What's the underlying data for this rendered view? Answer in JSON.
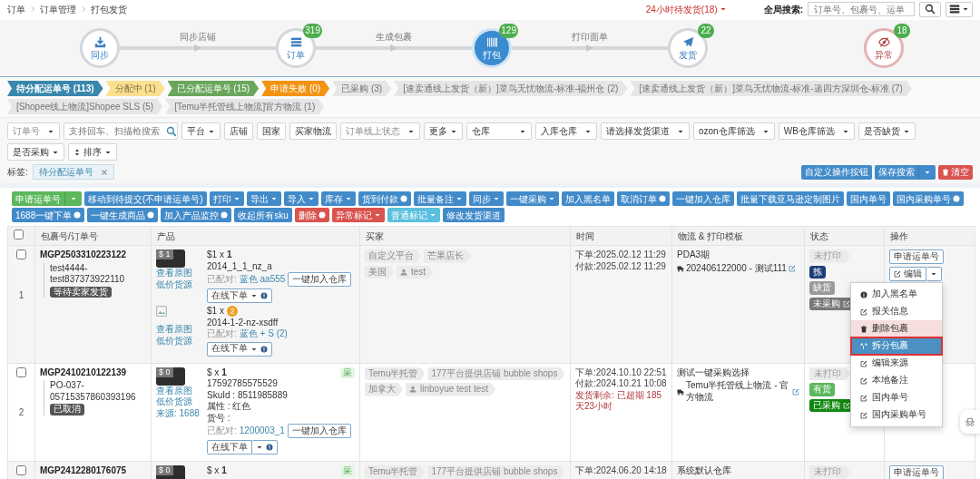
{
  "header": {
    "breadcrumb": [
      "订单",
      "订单管理",
      "打包发货"
    ],
    "alert_link": "24小时待发货(18)",
    "search_label": "全局搜索:",
    "search": {
      "placeholder": "订单号、包裹号、运单"
    }
  },
  "workflow": [
    {
      "kind": "sync",
      "label": "同步",
      "next_label": "同步店铺",
      "selected": false
    },
    {
      "kind": "orders",
      "label": "订单",
      "badge": "319",
      "next_label": "生成包裹",
      "selected": false
    },
    {
      "kind": "pack",
      "label": "打包",
      "badge": "129",
      "next_label": "打印面单",
      "selected": true
    },
    {
      "kind": "ship",
      "label": "发货",
      "badge": "22",
      "selected": false
    },
    {
      "kind": "error",
      "label": "异常",
      "badge": "18",
      "selected": false
    }
  ],
  "status_tabs": [
    {
      "label": "待分配运单号 (113)",
      "color": "#3a87ad",
      "selected": true
    },
    {
      "label": "分配中 (1)",
      "color": "#fbe08f",
      "selected": false
    },
    {
      "label": "已分配运单号 (15)",
      "color": "#6aa65b",
      "selected": false
    },
    {
      "label": "申请失败 (0)",
      "color": "#f39312",
      "selected": false
    },
    {
      "label": "已采购 (3)",
      "color": "#e6e6e6",
      "selected": false
    },
    {
      "label": "[速卖通线上发货（新）]菜鸟无忧物流-标准-福州仓 (2)",
      "color": "#e6e6e6",
      "selected": false
    },
    {
      "label": "[速卖通线上发货（新）]菜鸟无忧物流-标准-递四方深圳仓-标准 (7)",
      "color": "#e6e6e6",
      "selected": false
    },
    {
      "label": "[Shopee线上物流]Shopee SLS (5)",
      "color": "#e6e6e6",
      "selected": false
    },
    {
      "label": "[Temu半托管线上物流]官方物流 (1)",
      "color": "#e6e6e6",
      "selected": false
    }
  ],
  "filters": {
    "fields": [
      {
        "kind": "select",
        "placeholder": "订单号"
      },
      {
        "kind": "search",
        "placeholder": "支持回车、扫描枪搜索"
      },
      {
        "kind": "menu",
        "label": "平台"
      },
      {
        "kind": "button",
        "label": "店铺"
      },
      {
        "kind": "button",
        "label": "国家"
      },
      {
        "kind": "button",
        "label": "买家物流"
      },
      {
        "kind": "select",
        "placeholder": "订单线上状态"
      },
      {
        "kind": "menu",
        "label": "更多"
      },
      {
        "kind": "select",
        "value": "仓库"
      },
      {
        "kind": "select",
        "value": "入库仓库"
      },
      {
        "kind": "select",
        "value": "请选择发货渠道"
      },
      {
        "kind": "select",
        "value": "ozon仓库筛选"
      },
      {
        "kind": "select",
        "value": "WB仓库筛选"
      },
      {
        "kind": "menu",
        "label": "是否缺货"
      },
      {
        "kind": "menu",
        "label": "是否采购"
      },
      {
        "kind": "sort",
        "label": "排序"
      }
    ],
    "tag_label": "标签:",
    "tags": [
      "待分配运单号"
    ],
    "actions": [
      {
        "kind": "primary",
        "label": "自定义操作按钮"
      },
      {
        "kind": "split",
        "label": "保存搜索"
      },
      {
        "kind": "danger",
        "label": "清空"
      }
    ]
  },
  "toolbar": [
    [
      {
        "kind": "success",
        "label": "申请运单号",
        "split": true
      },
      {
        "kind": "primary",
        "label": "移动到待提交(不申请运单号)"
      },
      {
        "kind": "primary",
        "label": "打印",
        "caret": true
      },
      {
        "kind": "primary",
        "label": "导出",
        "caret": true
      },
      {
        "kind": "primary",
        "label": "导入",
        "caret": true
      },
      {
        "kind": "primary",
        "label": "库存",
        "caret": true
      },
      {
        "kind": "primary",
        "label": "货到付款",
        "alert": true
      },
      {
        "kind": "primary",
        "label": "批量备注",
        "caret": true
      },
      {
        "kind": "primary",
        "label": "同步",
        "caret": true
      },
      {
        "kind": "primary",
        "label": "一键采购",
        "caret": true
      },
      {
        "kind": "primary",
        "label": "加入黑名单"
      },
      {
        "kind": "primary",
        "label": "取消订单",
        "alert": true
      },
      {
        "kind": "primary",
        "label": "一键加入仓库"
      },
      {
        "kind": "primary",
        "label": "批量下载亚马逊定制图片"
      },
      {
        "kind": "primary",
        "label": "国内单号"
      },
      {
        "kind": "primary",
        "label": "国内采购单号",
        "alert": true
      },
      {
        "kind": "primary",
        "label": "1688一键下单",
        "alert": true
      },
      {
        "kind": "primary",
        "label": "一键生成商品",
        "alert": true
      },
      {
        "kind": "primary",
        "label": "加入产品监控",
        "alert": true
      }
    ],
    [
      {
        "kind": "primary",
        "label": "收起所有sku"
      },
      {
        "kind": "danger",
        "label": "删除",
        "alert": true
      },
      {
        "kind": "danger",
        "label": "异常标记",
        "caret": true
      },
      {
        "kind": "info",
        "label": "普通标记",
        "caret": true
      },
      {
        "kind": "primary",
        "label": "修改发货渠道"
      }
    ]
  ],
  "table": {
    "columns": [
      "包裹号/订单号",
      "产品",
      "买家",
      "时间",
      "物流 & 打印模板",
      "状态",
      "操作"
    ],
    "all_checked": false,
    "rows": [
      {
        "number": "1",
        "checked": false,
        "package_no": "MGP2503310223122",
        "order_no": "test4444-test837373922110",
        "order_state": "等待卖家发货",
        "products": [
          {
            "kind": "photo",
            "price_tag": "$ 1",
            "links": [
              "查看原图",
              "低价货源"
            ],
            "price": "$1 x",
            "qty": "1",
            "qty_flag": false,
            "lines": [
              "2014_1_1_nz_a"
            ],
            "matched_label": "已配对:",
            "matched": "蓝色 aa555",
            "buttons": [
              {
                "kind": "outline",
                "label": "一键加入仓库"
              },
              {
                "kind": "order",
                "label": "在线下单"
              }
            ]
          },
          {
            "kind": "broken-image",
            "links": [
              "查看原图",
              "低价货源"
            ],
            "price": "$1 x",
            "qty": "2",
            "qty_flag": true,
            "lines": [
              "2014-1-2-nz-xsdff"
            ],
            "matched_label": "已配对:",
            "matched": "蓝色 + S (2)",
            "buttons": [
              {
                "kind": "order",
                "label": "在线下单"
              }
            ]
          }
        ],
        "buyer": [
          [
            {
              "kind": "tag",
              "text": "自定义平台"
            },
            {
              "kind": "tag",
              "text": "芒果店长"
            }
          ],
          [
            {
              "kind": "tag",
              "text": "美国"
            },
            {
              "kind": "user",
              "text": "test"
            }
          ]
        ],
        "times": [
          {
            "kind": "normal",
            "text": "下单:2025.02.12 11:29"
          },
          {
            "kind": "normal",
            "text": "付款:2025.02.12 11:29"
          }
        ],
        "logistics": {
          "warehouse": "PDA3期",
          "channel": "202406122000 - 测试111"
        },
        "status": [
          {
            "kind": "print",
            "text": "未打印"
          },
          {
            "kind": "badge",
            "text": "拣",
            "color": "#1c3d78"
          },
          {
            "kind": "badge",
            "text": "缺货",
            "color": "#9a9a9a"
          },
          {
            "kind": "badge",
            "text": "未采购",
            "color": "#777777",
            "editable": true
          }
        ],
        "operations": [
          {
            "kind": "outline",
            "label": "申请运单号"
          },
          {
            "kind": "edit",
            "label": "编辑"
          }
        ]
      },
      {
        "number": "2",
        "checked": false,
        "package_no": "MGP2410210122139",
        "order_no": "PO-037-05715357860393196",
        "order_state": "已取消",
        "products": [
          {
            "kind": "photo",
            "price_tag": "$ 0",
            "links": [
              "查看原图",
              "低价货源",
              "来源: 1688"
            ],
            "price": "$ x",
            "qty": "1",
            "qty_flag": false,
            "purchase_mark": "采",
            "lines": [
              "17592785575529",
              "SkuId : 8511985889",
              "属性 : 红色",
              "货号 :"
            ],
            "matched_label": "已配对:",
            "matched": "1200003_1",
            "buttons": [
              {
                "kind": "outline",
                "label": "一键加入仓库"
              },
              {
                "kind": "order-split",
                "label": "在线下单"
              }
            ]
          }
        ],
        "buyer": [
          [
            {
              "kind": "tag",
              "text": "Temu半托管"
            },
            {
              "kind": "tag",
              "text": "177平台提供店铺 bubble shops"
            }
          ],
          [
            {
              "kind": "tag",
              "text": "加拿大"
            },
            {
              "kind": "user",
              "text": "linboyue test test"
            }
          ]
        ],
        "times": [
          {
            "kind": "normal",
            "text": "下单:2024.10.10 22:51"
          },
          {
            "kind": "normal",
            "text": "付款:2024.10.21 10:08"
          },
          {
            "kind": "warning",
            "text": "发货剩余: 已超期 185天23小时"
          }
        ],
        "logistics": {
          "warehouse": "测试一键采购选择",
          "channel": "Temu半托管线上物流 - 官方物流"
        },
        "status": [
          {
            "kind": "print",
            "text": "未打印"
          },
          {
            "kind": "badge",
            "text": "有货",
            "color": "#5cb85c"
          },
          {
            "kind": "badge",
            "text": "已采购",
            "color": "#118811",
            "editable": true
          }
        ]
      },
      {
        "checked": false,
        "package_no": "MGP2412280176075",
        "products": [
          {
            "kind": "photo",
            "price_tag": "$ 0",
            "price": "$ x",
            "qty": "1",
            "qty_flag": false,
            "purchase_mark": "采"
          }
        ],
        "buyer": [
          [
            {
              "kind": "tag",
              "text": "Temu半托管"
            },
            {
              "kind": "tag",
              "text": "177平台提供店铺 bubble shops"
            }
          ]
        ],
        "times": [
          {
            "kind": "normal",
            "text": "下单:2024.06.20 14:18"
          }
        ],
        "logistics": {
          "warehouse": "系统默认仓库"
        },
        "status": [
          {
            "kind": "print",
            "text": "未打印"
          }
        ],
        "operations": [
          {
            "kind": "outline",
            "label": "申请运单号"
          }
        ]
      }
    ]
  },
  "menu": {
    "items": [
      {
        "kind": "info",
        "label": "加入黑名单",
        "selected": false,
        "danger": false,
        "annotated": false
      },
      {
        "kind": "edit",
        "label": "报关信息",
        "selected": false,
        "danger": false,
        "annotated": false
      },
      {
        "kind": "trash",
        "label": "删除包裹",
        "selected": false,
        "danger": true,
        "annotated": false
      },
      {
        "kind": "split",
        "label": "拆分包裹",
        "selected": true,
        "danger": false,
        "annotated": true
      },
      {
        "kind": "edit",
        "label": "编辑来源",
        "selected": false,
        "danger": false,
        "annotated": false
      },
      {
        "kind": "edit",
        "label": "本地备注",
        "selected": false,
        "danger": false,
        "annotated": false
      },
      {
        "kind": "edit",
        "label": "国内单号",
        "selected": false,
        "danger": false,
        "annotated": false
      },
      {
        "kind": "edit",
        "label": "国内采购单号",
        "selected": false,
        "danger": false,
        "annotated": false
      }
    ]
  }
}
